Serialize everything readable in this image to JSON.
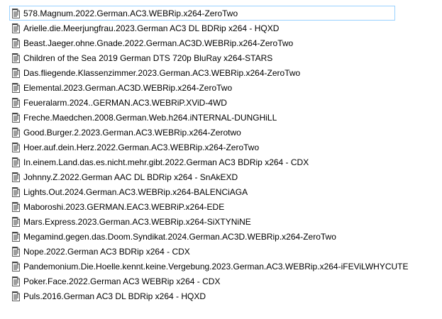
{
  "files": [
    {
      "name": "578.Magnum.2022.German.AC3.WEBRip.x264-ZeroTwo",
      "icon": "text-document-icon",
      "focused": true
    },
    {
      "name": "Arielle.die.Meerjungfrau.2023.German AC3 DL BDRip x264 - HQXD",
      "icon": "text-document-icon"
    },
    {
      "name": "Beast.Jaeger.ohne.Gnade.2022.German.AC3D.WEBRip.x264-ZeroTwo",
      "icon": "text-document-icon"
    },
    {
      "name": "Children of the Sea 2019 German DTS 720p BluRay x264-STARS",
      "icon": "text-document-icon"
    },
    {
      "name": "Das.fliegende.Klassenzimmer.2023.German.AC3.WEBRip.x264-ZeroTwo",
      "icon": "text-document-icon"
    },
    {
      "name": "Elemental.2023.German.AC3D.WEBRip.x264-ZeroTwo",
      "icon": "text-document-icon"
    },
    {
      "name": "Feueralarm.2024..GERMAN.AC3.WEBRiP.XViD-4WD",
      "icon": "text-document-icon"
    },
    {
      "name": "Freche.Maedchen.2008.German.Web.h264.iNTERNAL-DUNGHiLL",
      "icon": "text-document-icon"
    },
    {
      "name": "Good.Burger.2.2023.German.AC3.WEBRip.x264-Zerotwo",
      "icon": "text-document-icon"
    },
    {
      "name": "Hoer.auf.dein.Herz.2022.German.AC3.WEBRip.x264-ZeroTwo",
      "icon": "text-document-icon"
    },
    {
      "name": "In.einem.Land.das.es.nicht.mehr.gibt.2022.German AC3 BDRip x264 - CDX",
      "icon": "text-document-icon"
    },
    {
      "name": "Johnny.Z.2022.German AAC  DL BDRip x264 - SnAkEXD",
      "icon": "text-document-icon"
    },
    {
      "name": "Lights.Out.2024.German.AC3.WEBRip.x264-BALENCiAGA",
      "icon": "text-document-icon"
    },
    {
      "name": "Maboroshi.2023.GERMAN.EAC3.WEBRiP.x264-EDE",
      "icon": "text-document-icon"
    },
    {
      "name": "Mars.Express.2023.German.AC3.WEBRip.x264-SiXTYNiNE",
      "icon": "text-document-icon"
    },
    {
      "name": "Megamind.gegen.das.Doom.Syndikat.2024.German.AC3D.WEBRip.x264-ZeroTwo",
      "icon": "text-document-icon"
    },
    {
      "name": "Nope.2022.German AC3 BDRip x264 - CDX",
      "icon": "text-document-icon"
    },
    {
      "name": "Pandemonium.Die.Hoelle.kennt.keine.Vergebung.2023.German.AC3.WEBRip.x264-iFEViLWHYCUTE",
      "icon": "text-document-icon"
    },
    {
      "name": "Poker.Face.2022.German AC3 WEBRip x264 - CDX",
      "icon": "text-document-icon"
    },
    {
      "name": "Puls.2016.German AC3 DL BDRip x264 - HQXD",
      "icon": "text-document-icon"
    }
  ],
  "colors": {
    "focus_border": "#99d1ff",
    "text": "#000000",
    "background": "#ffffff"
  }
}
